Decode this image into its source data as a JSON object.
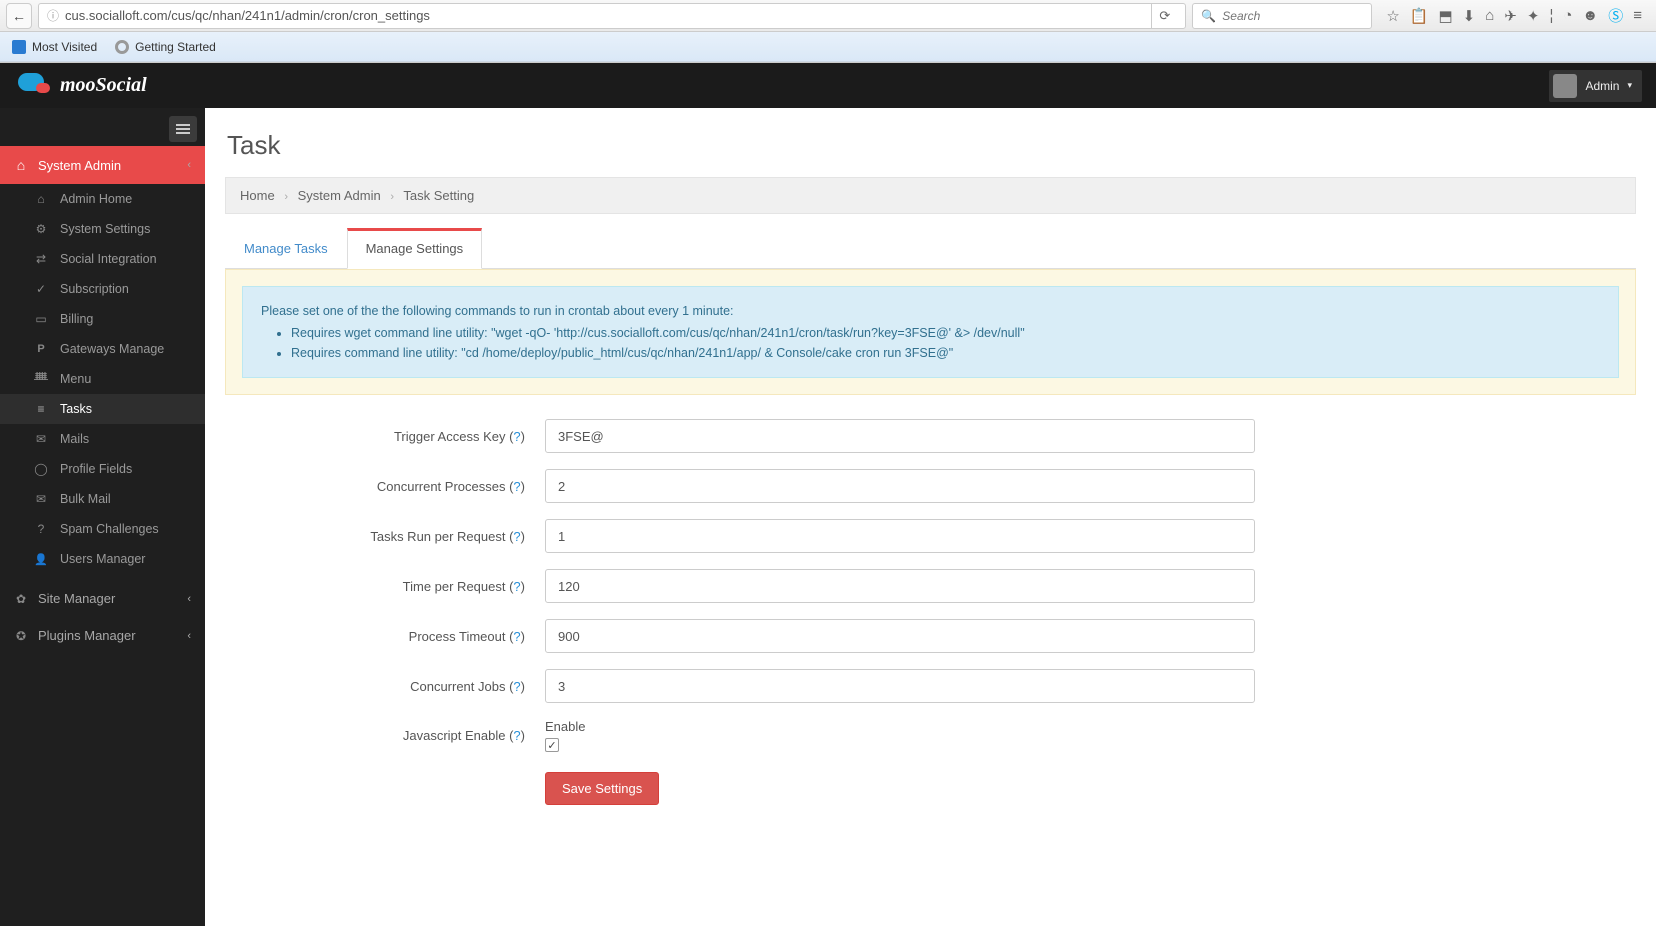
{
  "browser": {
    "url": "cus.socialloft.com/cus/qc/nhan/241n1/admin/cron/cron_settings",
    "search_placeholder": "Search",
    "bookmarks": {
      "most_visited": "Most Visited",
      "getting_started": "Getting Started"
    }
  },
  "header": {
    "logo": "mooSocial",
    "user_label": "Admin"
  },
  "sidebar": {
    "sections": {
      "system_admin": "System Admin",
      "site_manager": "Site Manager",
      "plugins_manager": "Plugins Manager"
    },
    "items": {
      "admin_home": "Admin Home",
      "system_settings": "System Settings",
      "social_integration": "Social Integration",
      "subscription": "Subscription",
      "billing": "Billing",
      "gateways_manage": "Gateways Manage",
      "menu": "Menu",
      "tasks": "Tasks",
      "mails": "Mails",
      "profile_fields": "Profile Fields",
      "bulk_mail": "Bulk Mail",
      "spam_challenges": "Spam Challenges",
      "users_manager": "Users Manager"
    }
  },
  "page": {
    "title": "Task",
    "breadcrumb": {
      "home": "Home",
      "system_admin": "System Admin",
      "task_setting": "Task Setting"
    },
    "tabs": {
      "manage_tasks": "Manage Tasks",
      "manage_settings": "Manage Settings"
    },
    "alert": {
      "intro": "Please set one of the the following commands to run in crontab about every 1 minute:",
      "line1": "Requires wget command line utility: \"wget -qO- 'http://cus.socialloft.com/cus/qc/nhan/241n1/cron/task/run?key=3FSE@' &> /dev/null\"",
      "line2": "Requires command line utility: \"cd /home/deploy/public_html/cus/qc/nhan/241n1/app/ & Console/cake cron run 3FSE@\""
    },
    "form": {
      "trigger_access_key": {
        "label": "Trigger Access Key (",
        "value": "3FSE@"
      },
      "concurrent_processes": {
        "label": "Concurrent Processes (",
        "value": "2"
      },
      "tasks_run_per_request": {
        "label": "Tasks Run per Request (",
        "value": "1"
      },
      "time_per_request": {
        "label": "Time per Request (",
        "value": "120"
      },
      "process_timeout": {
        "label": "Process Timeout (",
        "value": "900"
      },
      "concurrent_jobs": {
        "label": "Concurrent Jobs (",
        "value": "3"
      },
      "javascript_enable": {
        "label": "Javascript Enable (",
        "text": "Enable",
        "checked": true
      },
      "help_q": "?",
      "help_close": ")",
      "save_button": "Save Settings"
    }
  }
}
